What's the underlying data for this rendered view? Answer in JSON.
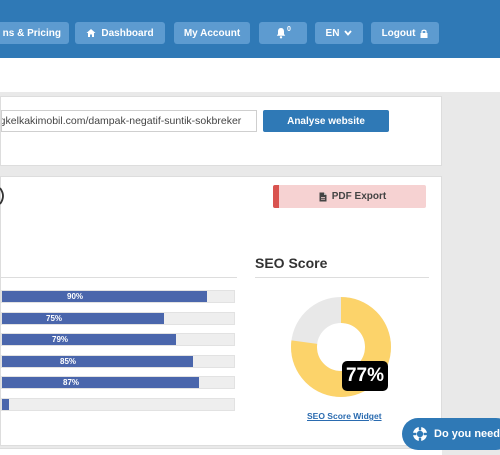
{
  "nav": {
    "plans_label": "ns & Pricing",
    "dashboard_label": "Dashboard",
    "account_label": "My Account",
    "notifications_count": "0",
    "lang_label": "EN",
    "logout_label": "Logout"
  },
  "analyse": {
    "url_value": "engkelkakimobil.com/dampak-negatif-suntik-sokbreker",
    "button_label": "Analyse website"
  },
  "report": {
    "title_fragment": ")",
    "pdf_label": "PDF Export",
    "bars": [
      {
        "percent": 90,
        "label": "90%"
      },
      {
        "percent": 75,
        "label": "75%"
      },
      {
        "percent": 79,
        "label": "79%"
      },
      {
        "percent": 85,
        "label": "85%"
      },
      {
        "percent": 87,
        "label": "87%"
      },
      {
        "percent": 3,
        "label": ""
      }
    ]
  },
  "seo": {
    "title": "SEO Score",
    "score": 77,
    "score_label": "77%",
    "widget_link": "SEO Score Widget",
    "score_color": "#fcd36a",
    "rest_color": "#e8e8e8"
  },
  "help": {
    "label": "Do you need"
  },
  "colors": {
    "primary": "#2f79b6",
    "bar": "#4a66ac"
  }
}
